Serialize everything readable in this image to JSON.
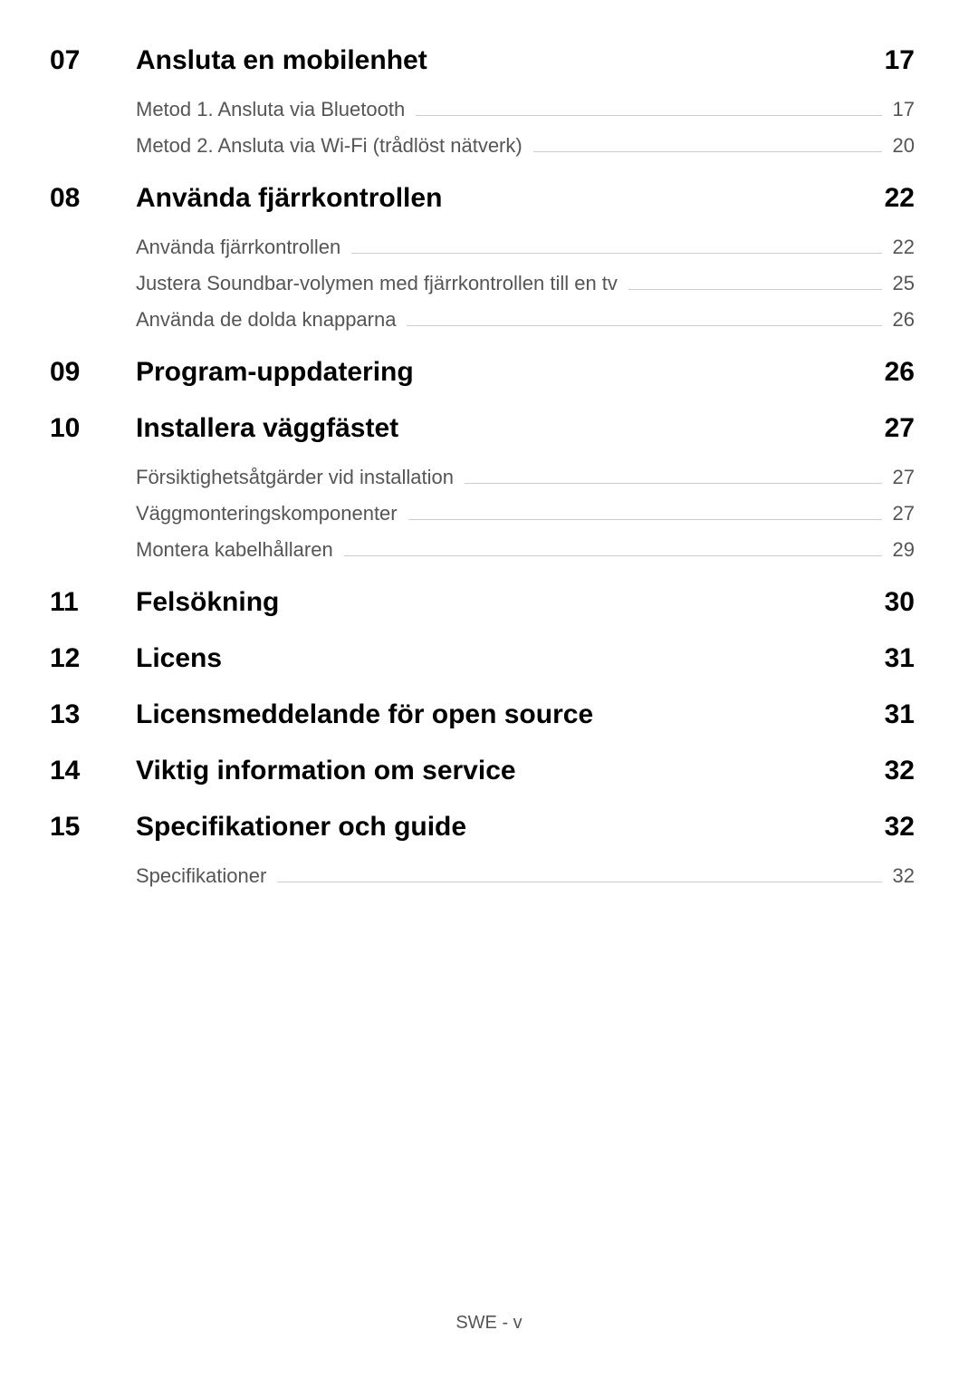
{
  "toc": [
    {
      "number": "07",
      "title": "Ansluta en mobilenhet",
      "page": "17",
      "items": [
        {
          "title": "Metod 1. Ansluta via Bluetooth",
          "page": "17"
        },
        {
          "title": "Metod 2. Ansluta via Wi-Fi (trådlöst nätverk)",
          "page": "20"
        }
      ]
    },
    {
      "number": "08",
      "title": "Använda fjärrkontrollen",
      "page": "22",
      "items": [
        {
          "title": "Använda fjärrkontrollen",
          "page": "22"
        },
        {
          "title": "Justera Soundbar-volymen med fjärrkontrollen till en tv",
          "page": "25"
        },
        {
          "title": "Använda de dolda knapparna",
          "page": "26"
        }
      ]
    },
    {
      "number": "09",
      "title": "Program-uppdatering",
      "page": "26",
      "items": []
    },
    {
      "number": "10",
      "title": "Installera väggfästet",
      "page": "27",
      "items": [
        {
          "title": "Försiktighetsåtgärder vid installation",
          "page": "27"
        },
        {
          "title": "Väggmonteringskomponenter",
          "page": "27"
        },
        {
          "title": "Montera kabelhållaren",
          "page": "29"
        }
      ]
    },
    {
      "number": "11",
      "title": "Felsökning",
      "page": "30",
      "items": []
    },
    {
      "number": "12",
      "title": "Licens",
      "page": "31",
      "items": []
    },
    {
      "number": "13",
      "title": "Licensmeddelande för open source",
      "page": "31",
      "items": []
    },
    {
      "number": "14",
      "title": "Viktig information om service",
      "page": "32",
      "items": []
    },
    {
      "number": "15",
      "title": "Specifikationer och guide",
      "page": "32",
      "items": [
        {
          "title": "Specifikationer",
          "page": "32"
        }
      ]
    }
  ],
  "footer": "SWE - v"
}
